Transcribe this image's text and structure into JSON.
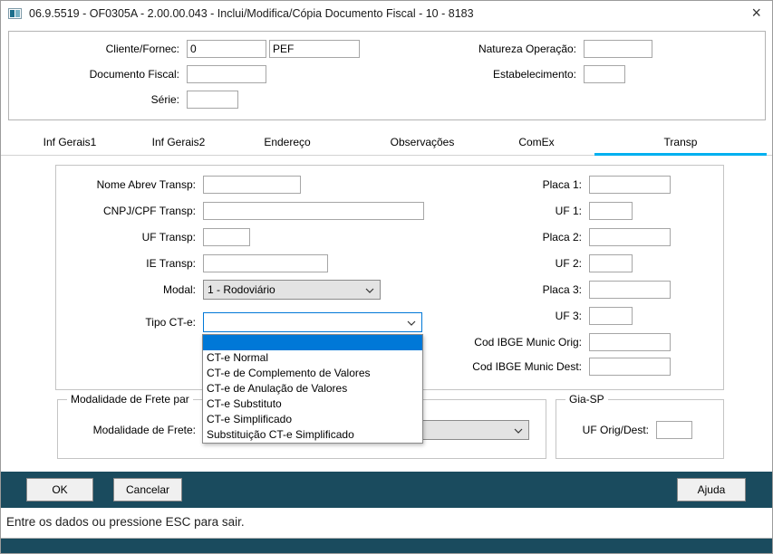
{
  "window": {
    "title": "06.9.5519 - OF0305A - 2.00.00.043 - Inclui/Modifica/Cópia Documento Fiscal - 10 - 8183",
    "close_glyph": "×"
  },
  "colors": {
    "teal_bar": "#1a4b5e",
    "tab_accent": "#00b0f0",
    "highlight": "#0078d7"
  },
  "header": {
    "fields": {
      "cliente_fornec": {
        "label": "Cliente/Fornec:",
        "value": "0",
        "desc": "PEF"
      },
      "natureza_operacao": {
        "label": "Natureza Operação:",
        "value": ""
      },
      "documento_fiscal": {
        "label": "Documento Fiscal:",
        "value": ""
      },
      "estabelecimento": {
        "label": "Estabelecimento:",
        "value": ""
      },
      "serie": {
        "label": "Série:",
        "value": ""
      }
    }
  },
  "tabs": [
    {
      "label": "Inf Gerais1",
      "active": false
    },
    {
      "label": "Inf Gerais2",
      "active": false
    },
    {
      "label": "Endereço",
      "active": false
    },
    {
      "label": "Observações",
      "active": false
    },
    {
      "label": "ComEx",
      "active": false
    },
    {
      "label": "Transp",
      "active": true
    }
  ],
  "transp": {
    "fields": {
      "nome_abrev": {
        "label": "Nome Abrev Transp:",
        "value": ""
      },
      "cnpj_cpf": {
        "label": "CNPJ/CPF Transp:",
        "value": ""
      },
      "uf_transp": {
        "label": "UF Transp:",
        "value": ""
      },
      "ie_transp": {
        "label": "IE Transp:",
        "value": ""
      },
      "modal": {
        "label": "Modal:",
        "value": "1 - Rodoviário"
      },
      "tipo_cte": {
        "label": "Tipo CT-e:",
        "value": ""
      },
      "placa_1": {
        "label": "Placa 1:",
        "value": ""
      },
      "uf_1": {
        "label": "UF 1:",
        "value": ""
      },
      "placa_2": {
        "label": "Placa 2:",
        "value": ""
      },
      "uf_2": {
        "label": "UF 2:",
        "value": ""
      },
      "placa_3": {
        "label": "Placa 3:",
        "value": ""
      },
      "uf_3": {
        "label": "UF 3:",
        "value": ""
      },
      "cod_ibge_munic_orig": {
        "label": "Cod IBGE Munic Orig:",
        "value": ""
      },
      "cod_ibge_munic_dest": {
        "label": "Cod IBGE Munic Dest:",
        "value": ""
      }
    },
    "tipo_cte_dropdown": {
      "highlighted_index": 0,
      "options": [
        "",
        "CT-e Normal",
        "CT-e de Complemento de Valores",
        "CT-e de Anulação de Valores",
        "CT-e Substituto",
        "CT-e Simplificado",
        "Substituição CT-e Simplificado"
      ]
    }
  },
  "modalidade_group": {
    "legend": "Modalidade de Frete par",
    "field_label": "Modalidade de Frete:",
    "value": ""
  },
  "gia_group": {
    "legend": "Gia-SP",
    "field_label": "UF Orig/Dest:",
    "value": ""
  },
  "footer": {
    "buttons": [
      {
        "label": "OK"
      },
      {
        "label": "Cancelar"
      },
      {
        "label": "Ajuda"
      }
    ]
  },
  "statusbar": {
    "message": "Entre os dados ou pressione ESC para sair."
  }
}
